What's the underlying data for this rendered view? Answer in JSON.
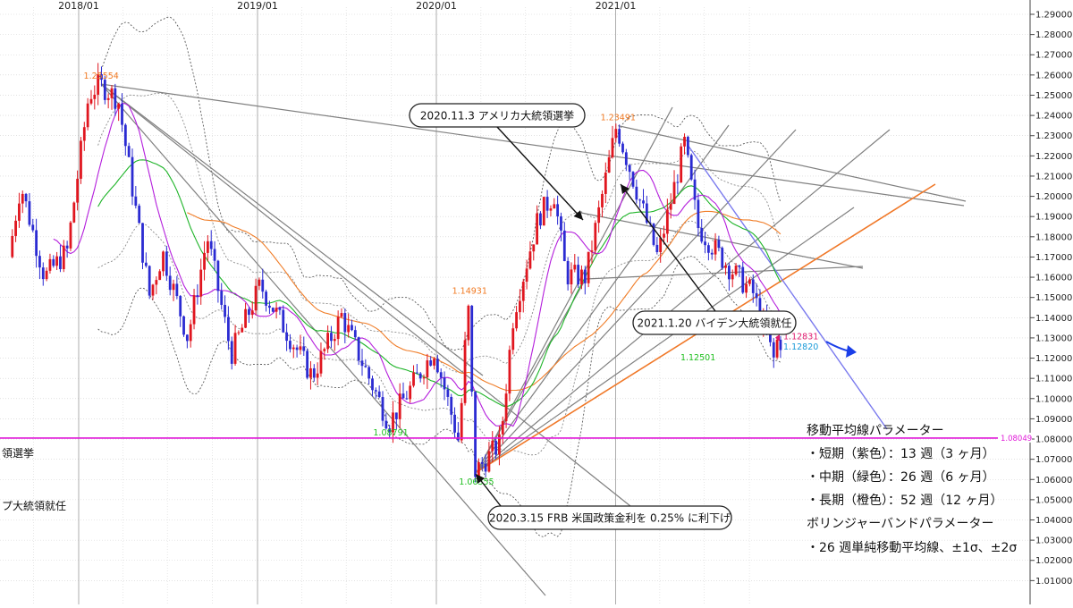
{
  "chart_data": {
    "type": "candlestick",
    "instrument_hint": "weekly price chart",
    "y_axis": {
      "min": 1.0,
      "max": 1.29,
      "step": 0.01,
      "side": "right",
      "tick_labels": [
        "1.29000",
        "1.28000",
        "1.27000",
        "1.26000",
        "1.25000",
        "1.24000",
        "1.23000",
        "1.22000",
        "1.21000",
        "1.20000",
        "1.19000",
        "1.18000",
        "1.17000",
        "1.16000",
        "1.15000",
        "1.14000",
        "1.13000",
        "1.12000",
        "1.11000",
        "1.10000",
        "1.09000",
        "1.08000",
        "1.07000",
        "1.06000",
        "1.05000",
        "1.04000",
        "1.03000",
        "1.02000",
        "1.01000"
      ]
    },
    "x_axis": {
      "type": "weekly",
      "start": "2017-08",
      "end": "2021-06",
      "tick_labels": [
        "2018/01",
        "2019/01",
        "2020/01",
        "2021/01"
      ]
    },
    "grid": true,
    "colors": {
      "up": "#e0161f",
      "down": "#2b2bd2",
      "sma13": "#b41edc",
      "sma26": "#1eb428",
      "sma52": "#f07d28",
      "bands": "#555555",
      "trend": "#808080",
      "trend_orange": "#f07828",
      "trend_blue": "#7a7aee",
      "hline": "#e019d8",
      "price_magenta": "#e0196e",
      "price_cyan": "#1a9ad8",
      "label_orange": "#f07820",
      "label_green": "#20c020"
    },
    "price_labels": [
      {
        "text": "1.25554",
        "date": "2018-02-16",
        "price": 1.2555,
        "color": "orange"
      },
      {
        "text": "1.14931",
        "date": "2020-03-09",
        "price": 1.1493,
        "color": "orange"
      },
      {
        "text": "1.23491",
        "date": "2021-01-06",
        "price": 1.2349,
        "color": "orange"
      },
      {
        "text": "1.08791",
        "date": "2019-09-30",
        "price": 1.0879,
        "color": "green"
      },
      {
        "text": "1.06355",
        "date": "2020-03-23",
        "price": 1.0636,
        "color": "green"
      },
      {
        "text": "1.12501",
        "date": "2021-06-18",
        "price": 1.125,
        "color": "green"
      }
    ],
    "current_prices": [
      {
        "text": "1.12831",
        "price": 1.12831,
        "color": "magenta"
      },
      {
        "text": "1.12820",
        "price": 1.1282,
        "color": "cyan"
      }
    ],
    "horizontal_line": {
      "price": 1.08049,
      "label": "1.08049"
    },
    "partial_left_labels": [
      "領選挙",
      "プ大統領就任"
    ],
    "annotations": [
      {
        "id": "election",
        "text": "2020.11.3 アメリカ大統領選挙"
      },
      {
        "id": "inauguration",
        "text": "2021.1.20 バイデン大統領就任"
      },
      {
        "id": "rate-cut",
        "text": "2020.3.15 FRB 米国政策金利を 0.25% に利下げ"
      }
    ],
    "parameters": {
      "ma_title": "移動平均線パラメーター",
      "ma_items": [
        "・短期（紫色）：13 週（3 ヶ月）",
        "・中期（緑色）：26 週（6 ヶ月）",
        "・長期（橙色）：52 週（12 ヶ月）"
      ],
      "bb_title": "ボリンジャーバンドパラメーター",
      "bb_items": [
        "・26 週単純移動平均線、±1σ、±2σ"
      ]
    },
    "price_path": [
      {
        "date": "2017-08-15",
        "price": 1.17
      },
      {
        "date": "2017-09-08",
        "price": 1.206
      },
      {
        "date": "2017-10-27",
        "price": 1.16
      },
      {
        "date": "2017-12-12",
        "price": 1.173
      },
      {
        "date": "2018-01-25",
        "price": 1.25
      },
      {
        "date": "2018-02-16",
        "price": 1.2555
      },
      {
        "date": "2018-03-26",
        "price": 1.248
      },
      {
        "date": "2018-05-29",
        "price": 1.151
      },
      {
        "date": "2018-06-25",
        "price": 1.172
      },
      {
        "date": "2018-08-15",
        "price": 1.13
      },
      {
        "date": "2018-09-24",
        "price": 1.18
      },
      {
        "date": "2018-11-12",
        "price": 1.122
      },
      {
        "date": "2019-01-10",
        "price": 1.156
      },
      {
        "date": "2019-04-26",
        "price": 1.111
      },
      {
        "date": "2019-06-25",
        "price": 1.141
      },
      {
        "date": "2019-09-30",
        "price": 1.0879
      },
      {
        "date": "2019-12-31",
        "price": 1.124
      },
      {
        "date": "2020-02-20",
        "price": 1.078
      },
      {
        "date": "2020-03-09",
        "price": 1.1493
      },
      {
        "date": "2020-03-23",
        "price": 1.0636
      },
      {
        "date": "2020-05-14",
        "price": 1.078
      },
      {
        "date": "2020-06-10",
        "price": 1.142
      },
      {
        "date": "2020-07-31",
        "price": 1.19
      },
      {
        "date": "2020-09-01",
        "price": 1.201
      },
      {
        "date": "2020-09-25",
        "price": 1.161
      },
      {
        "date": "2020-11-04",
        "price": 1.16
      },
      {
        "date": "2021-01-06",
        "price": 1.2349
      },
      {
        "date": "2021-03-31",
        "price": 1.17
      },
      {
        "date": "2021-05-25",
        "price": 1.226
      },
      {
        "date": "2021-06-21",
        "price": 1.185
      },
      {
        "date": "2021-08-20",
        "price": 1.166
      },
      {
        "date": "2021-10-12",
        "price": 1.152
      },
      {
        "date": "2021-11-24",
        "price": 1.1186
      },
      {
        "date": "2021-11-30",
        "price": 1.1283
      }
    ]
  }
}
